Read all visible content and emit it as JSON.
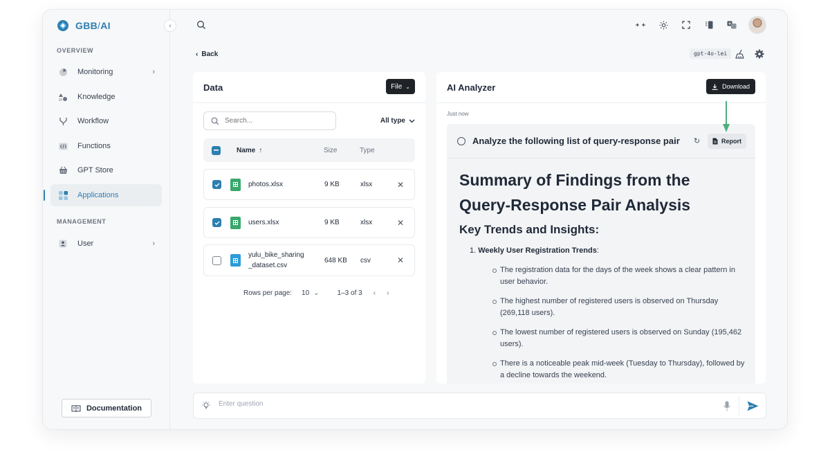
{
  "app": {
    "brand": "GBB",
    "brand_sub": "AI"
  },
  "sidebar": {
    "overview_label": "OVERVIEW",
    "management_label": "MANAGEMENT",
    "items": [
      {
        "label": "Monitoring",
        "has_children": true
      },
      {
        "label": "Knowledge"
      },
      {
        "label": "Workflow"
      },
      {
        "label": "Functions"
      },
      {
        "label": "GPT Store"
      },
      {
        "label": "Applications",
        "active": true
      }
    ],
    "management_items": [
      {
        "label": "User",
        "has_children": true
      }
    ],
    "documentation_label": "Documentation"
  },
  "header": {
    "back_label": "Back",
    "model_badge": "gpt-4o-lei"
  },
  "data_panel": {
    "title": "Data",
    "file_button": "File",
    "search_placeholder": "Search...",
    "type_filter": "All type",
    "columns": {
      "name": "Name",
      "size": "Size",
      "type": "Type"
    },
    "files": [
      {
        "name": "photos.xlsx",
        "size": "9 KB",
        "type": "xlsx",
        "checked": true
      },
      {
        "name": "users.xlsx",
        "size": "9 KB",
        "type": "xlsx",
        "checked": true
      },
      {
        "name": "yulu_bike_sharing\n_dataset.csv",
        "size": "648 KB",
        "type": "csv",
        "checked": false
      }
    ],
    "pagination": {
      "rows_per_page_label": "Rows per page:",
      "rows_per_page": "10",
      "range": "1–3 of 3"
    }
  },
  "ai_panel": {
    "title": "AI Analyzer",
    "download_label": "Download",
    "timestamp": "Just now",
    "query": "Analyze the following list of query-response pair",
    "report_label": "Report",
    "summary_title": "Summary of Findings from the Query-Response Pair Analysis",
    "key_title": "Key Trends and Insights:",
    "item_number": "1.",
    "item_heading": "Weekly User Registration Trends",
    "bullets": [
      "The registration data for the days of the week shows a clear pattern in user behavior.",
      "The highest number of registered users is observed on Thursday (269,118 users).",
      "The lowest number of registered users is observed on Sunday (195,462 users).",
      "There is a noticeable peak mid-week (Tuesday to Thursday), followed by a decline towards the weekend."
    ]
  },
  "question_bar": {
    "placeholder": "Enter question"
  },
  "colors": {
    "accent": "#2d7fb0",
    "dark_button": "#1f2328",
    "arrow": "#4caf7d"
  }
}
